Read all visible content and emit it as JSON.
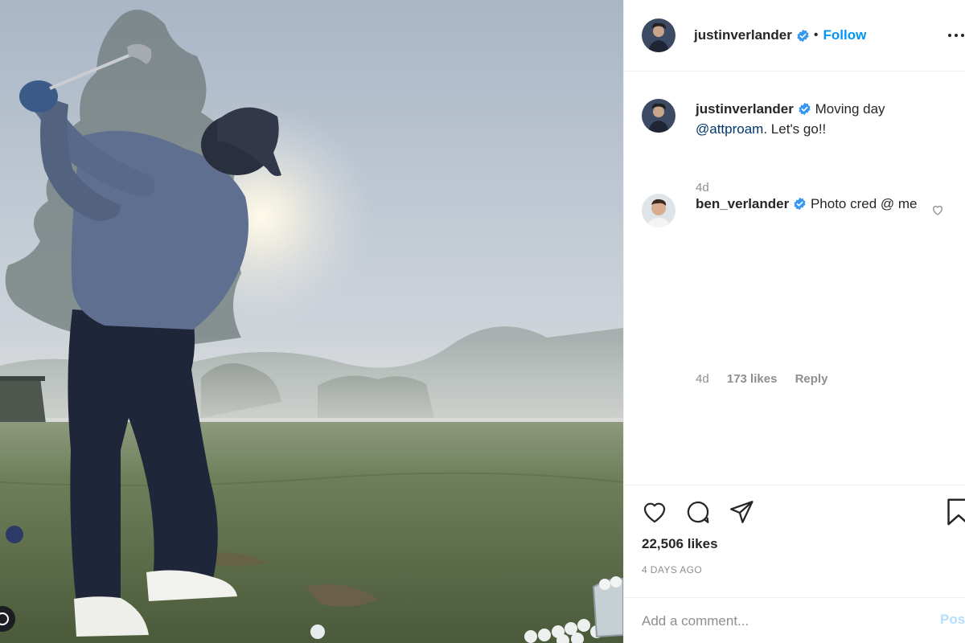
{
  "post": {
    "author": "justinverlander",
    "follow_label": "Follow",
    "dot": "•",
    "likes": "22,506 likes",
    "timestamp": "4 DAYS AGO"
  },
  "caption": {
    "username": "justinverlander",
    "text_before": " Moving day ",
    "mention": "@attproam",
    "text_after": ". Let's go!!",
    "age": "4d"
  },
  "comments": [
    {
      "username": "ben_verlander",
      "text": " Photo cred @ me",
      "age": "4d",
      "likes": "173 likes",
      "reply_label": "Reply"
    }
  ],
  "composer": {
    "placeholder": "Add a comment...",
    "post_label": "Post"
  },
  "colors": {
    "accent": "#0095f6",
    "verified": "#3897f0",
    "secondary_text": "#8e8e8e"
  },
  "icons": [
    "verified-badge-icon",
    "more-options-icon",
    "heart-icon",
    "comment-icon",
    "share-icon",
    "bookmark-icon",
    "small-heart-icon"
  ]
}
